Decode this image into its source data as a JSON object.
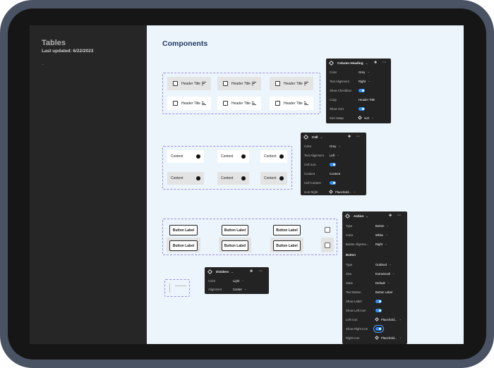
{
  "sidebar": {
    "title": "Tables",
    "updated": "Last updated: 6/22/2023",
    "dot": "."
  },
  "main": {
    "title": "Components"
  },
  "headers": {
    "label": "Header Title",
    "cells": [
      "Header Title",
      "Header Title",
      "Header Title",
      "Header Title",
      "Header Title",
      "Header Title"
    ]
  },
  "cells": {
    "items": [
      "Content",
      "Content",
      "Content",
      "Content",
      "Content",
      "Content"
    ]
  },
  "actions": {
    "buttons": [
      "Button Label",
      "Button Label",
      "Button Label",
      "Button Label",
      "Button Label",
      "Button Label"
    ]
  },
  "panel_column": {
    "title": "Column Heading",
    "rows": [
      {
        "label": "Color",
        "value": "Grey"
      },
      {
        "label": "Text Alignment",
        "value": "Right"
      },
      {
        "label": "Show Checkbox"
      },
      {
        "label": "Copy",
        "value": "Header Title"
      },
      {
        "label": "Show Sort"
      },
      {
        "label": "Sort Swap",
        "value": "sort"
      }
    ]
  },
  "panel_cell": {
    "title": "Cell",
    "rows": [
      {
        "label": "Color",
        "value": "Grey"
      },
      {
        "label": "Text Alignment",
        "value": "Left"
      },
      {
        "label": "Cell Icon"
      },
      {
        "label": "Content",
        "value": "Content"
      },
      {
        "label": "Cell Content"
      },
      {
        "label": "Icon Right",
        "value": "Placehold..."
      }
    ]
  },
  "panel_action": {
    "title": "Action",
    "rows": [
      {
        "label": "Type",
        "value": "Button"
      },
      {
        "label": "Color",
        "value": "White"
      },
      {
        "label": "Button Alignme...",
        "value": "Right"
      }
    ],
    "section": "Button",
    "rows2": [
      {
        "label": "Type",
        "value": "Outlined"
      },
      {
        "label": "Size",
        "value": "ExtraSmall"
      },
      {
        "label": "State",
        "value": "Default"
      },
      {
        "label": "Text Button",
        "value": "Button Label"
      },
      {
        "label": "Show Label"
      },
      {
        "label": "Show Left Icon"
      },
      {
        "label": "Left Icon",
        "value": "Placehold..."
      },
      {
        "label": "Show Right Icon"
      },
      {
        "label": "Right Icon",
        "value": "Placehold..."
      }
    ]
  },
  "panel_dividers": {
    "title": "Dividers",
    "rows": [
      {
        "label": "Color",
        "value": "Light"
      },
      {
        "label": "Alignment",
        "value": "Center"
      }
    ]
  },
  "colors": {
    "sidebar": "#262626",
    "canvas": "#ecf5fb",
    "title": "#213a63",
    "toggle": "#2f8ef8",
    "selection": "#a08ee6"
  }
}
